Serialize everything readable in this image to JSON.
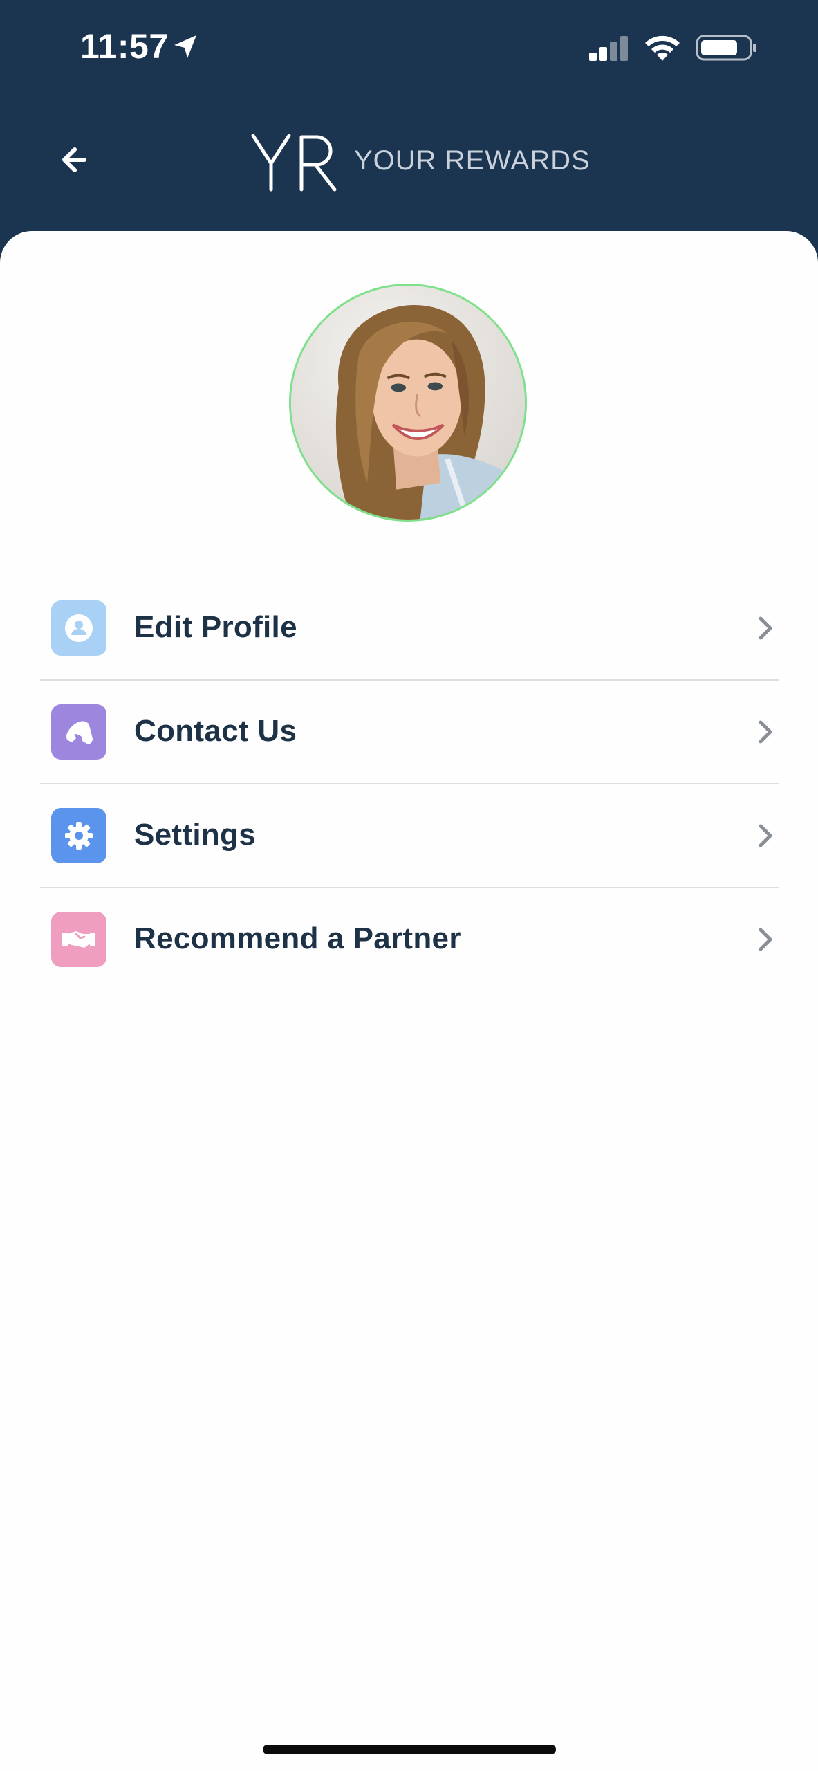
{
  "status_bar": {
    "time": "11:57",
    "icons": [
      "location-arrow-icon",
      "cellular-signal-icon",
      "wifi-icon",
      "battery-icon"
    ]
  },
  "header": {
    "back_icon": "arrow-left-icon",
    "logo_mark": "YR",
    "logo_text": "YOUR REWARDS"
  },
  "profile": {
    "avatar_border_color": "#7ee08a"
  },
  "menu": {
    "items": [
      {
        "label": "Edit Profile",
        "icon": "user-icon",
        "icon_color": "#a8d1f5"
      },
      {
        "label": "Contact Us",
        "icon": "phone-icon",
        "icon_color": "#9d86de"
      },
      {
        "label": "Settings",
        "icon": "gear-icon",
        "icon_color": "#5b94ec"
      },
      {
        "label": "Recommend a Partner",
        "icon": "handshake-icon",
        "icon_color": "#ef9ec0"
      }
    ]
  },
  "colors": {
    "header_bg": "#1b3450",
    "text_primary": "#1d3147",
    "divider": "#dcdfe3"
  }
}
